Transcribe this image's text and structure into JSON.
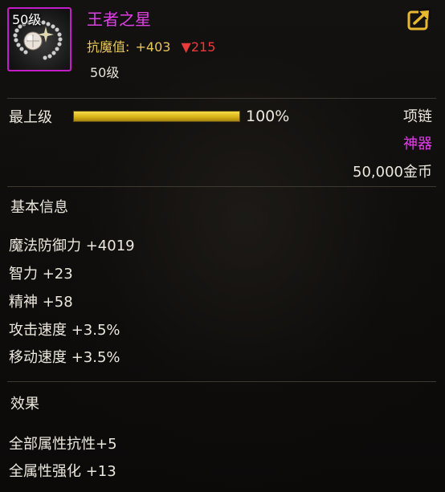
{
  "item": {
    "icon_level": "50级",
    "name": "王者之星",
    "resist_label": "抗魔值:",
    "resist_value": "+403",
    "resist_down_value": "215",
    "level_text": "50级",
    "share_icon": "share-export-icon"
  },
  "grade": {
    "label": "最上级",
    "progress": 1.0,
    "progress_text": "100%"
  },
  "meta": {
    "type": "项链",
    "rarity": "神器",
    "price": "50,000金币"
  },
  "basic": {
    "title": "基本信息",
    "stats": [
      "魔法防御力 +4019",
      "智力 +23",
      "精神 +58",
      "攻击速度 +3.5%",
      "移动速度 +3.5%"
    ]
  },
  "effects": {
    "title": "效果",
    "lines": [
      "全部属性抗性+5",
      "全属性强化 +13"
    ]
  },
  "colors": {
    "name": "#e23ee8",
    "rarity": "#e23ee8",
    "resist": "#e8c65a",
    "resist_down": "#e83a3a",
    "progress": "#e0b820"
  }
}
